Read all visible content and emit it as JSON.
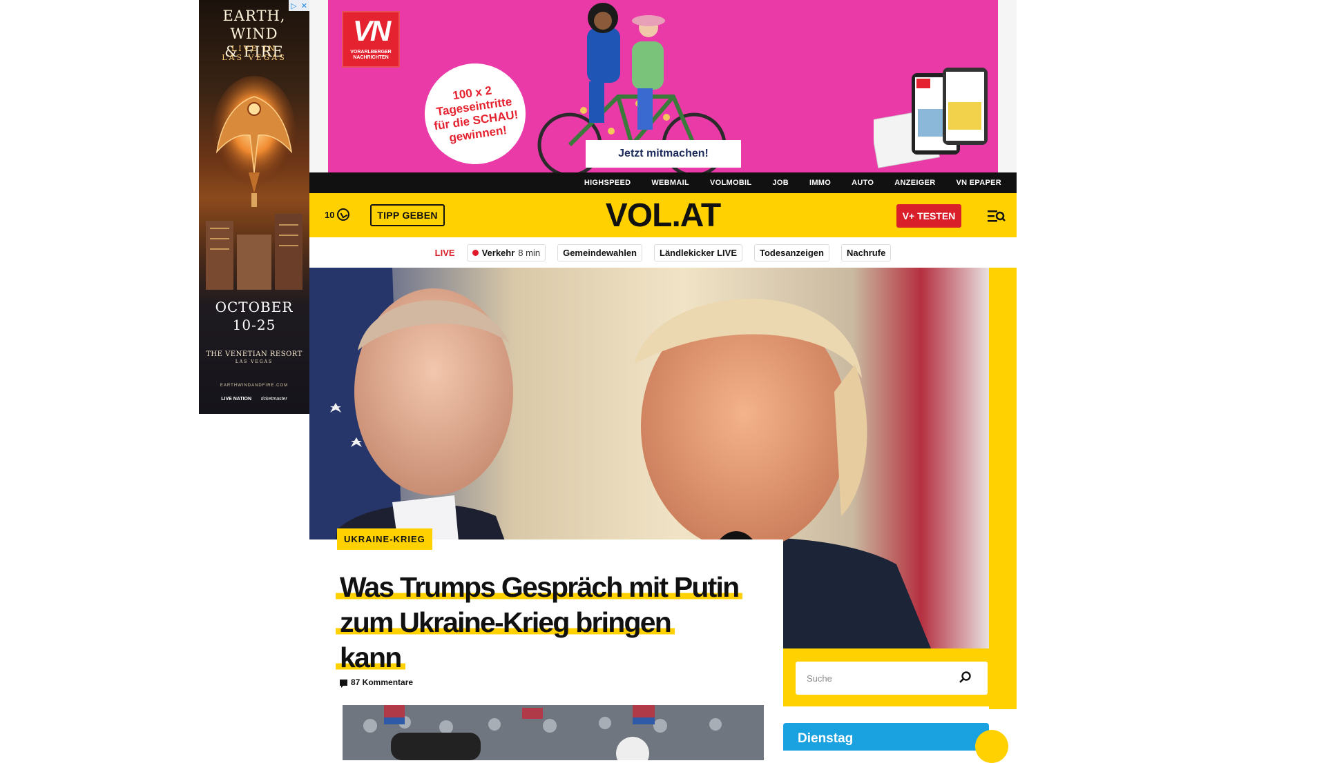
{
  "side_ad": {
    "adchoices": [
      "▷",
      "✕"
    ],
    "title_line1": "EARTH, WIND",
    "title_line2": "& FIRE",
    "subtitle_line1": "LIVE IN",
    "subtitle_line2": "LAS VEGAS",
    "date_line1": "OCTOBER",
    "date_line2": "10-25",
    "venue": "THE VENETIAN RESORT",
    "venue_sub": "LAS VEGAS",
    "url": "EARTHWINDANDFIRE.COM",
    "sponsor1": "LIVE NATION",
    "sponsor2": "ticketmaster"
  },
  "banner": {
    "logo": "VN",
    "logo_name_line1": "VORARLBERGER",
    "logo_name_line2": "NACHRICHTEN",
    "promo_line1": "100 x 2",
    "promo_line2": "Tageseintritte",
    "promo_line3": "für die SCHAU!",
    "promo_line4": "gewinnen!",
    "cta": "Jetzt mitmachen!"
  },
  "topnav": [
    "HIGHSPEED",
    "WEBMAIL",
    "VOLMOBIL",
    "JOB",
    "IMMO",
    "AUTO",
    "ANZEIGER",
    "VN EPAPER"
  ],
  "header": {
    "count": "10",
    "tipp": "TIPP GEBEN",
    "logo": "VOL.AT",
    "vplus": "V+ TESTEN"
  },
  "livebar": {
    "live": "LIVE",
    "chips": [
      {
        "label": "Verkehr",
        "time": "8 min"
      },
      {
        "label": "Gemeindewahlen"
      },
      {
        "label": "Ländlekicker LIVE"
      },
      {
        "label": "Todesanzeigen"
      },
      {
        "label": "Nachrufe"
      }
    ]
  },
  "article": {
    "kicker": "UKRAINE-KRIEG",
    "headline_l1": "Was Trumps Gespräch mit Putin",
    "headline_l2": "zum Ukraine-Krieg bringen",
    "headline_l3": "kann",
    "comments": "87 Kommentare"
  },
  "search": {
    "placeholder": "Suche"
  },
  "weather": {
    "day": "Dienstag"
  },
  "colors": {
    "brand_yellow": "#ffd100",
    "live_red": "#d9202a",
    "banner_pink": "#ea3aa8",
    "weather_blue": "#1aa1e0"
  }
}
